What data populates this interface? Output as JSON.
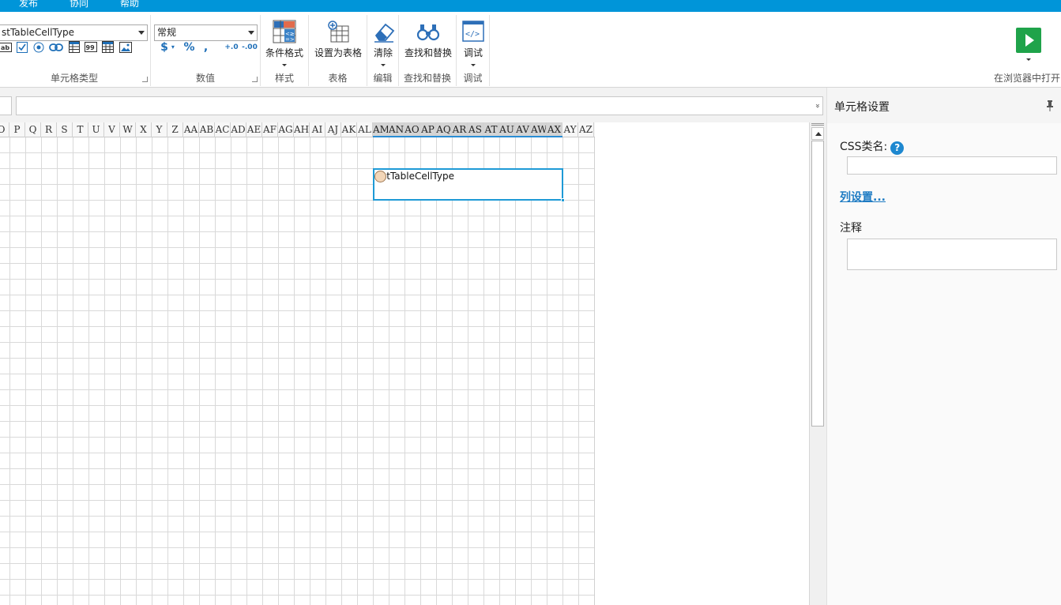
{
  "menubar": {
    "items": [
      {
        "label": "发布"
      },
      {
        "label": "协同"
      },
      {
        "label": "帮助"
      }
    ]
  },
  "ribbon": {
    "cell_type": {
      "combo_value": "stTableCellType",
      "group_label": "单元格类型",
      "icons": [
        "textbox-icon",
        "checkbox-icon",
        "radio-icon",
        "hyperlink-icon",
        "table-icon",
        "number-icon",
        "grid-icon",
        "image-icon"
      ]
    },
    "number": {
      "combo_value": "常规",
      "group_label": "数值",
      "currency_symbol": "$",
      "percent_symbol": "%",
      "comma_symbol": ",",
      "inc_decimal_label": "+.0",
      "dec_decimal_label": "-.00"
    },
    "style": {
      "button_label": "条件格式",
      "group_label": "样式"
    },
    "table": {
      "button_label": "设置为表格",
      "group_label": "表格"
    },
    "edit": {
      "button_label": "清除",
      "group_label": "编辑"
    },
    "find": {
      "button_label": "查找和替换",
      "group_label": "查找和替换"
    },
    "debug": {
      "button_label": "调试",
      "group_label": "调试"
    },
    "run": {
      "label": "在浏览器中打开",
      "accent": "#1fa34a"
    }
  },
  "formula_bar": {
    "value": "",
    "expand_glyph": "»"
  },
  "sheet": {
    "columns": [
      "O",
      "P",
      "Q",
      "R",
      "S",
      "T",
      "U",
      "V",
      "W",
      "X",
      "Y",
      "Z",
      "AA",
      "AB",
      "AC",
      "AD",
      "AE",
      "AF",
      "AG",
      "AH",
      "AI",
      "AJ",
      "AK",
      "AL",
      "AM",
      "AN",
      "AO",
      "AP",
      "AQ",
      "AR",
      "AS",
      "AT",
      "AU",
      "AV",
      "AW",
      "AX",
      "AY",
      "AZ"
    ],
    "selected_columns_from": "AM",
    "selected_columns_to": "AX",
    "selected_cell_text": "stTableCellType",
    "selection_color": "#1e9ad6"
  },
  "panel": {
    "title": "单元格设置",
    "css_label": "CSS类名:",
    "css_value": "",
    "column_settings_link": "列设置...",
    "comment_label": "注释",
    "comment_value": ""
  }
}
